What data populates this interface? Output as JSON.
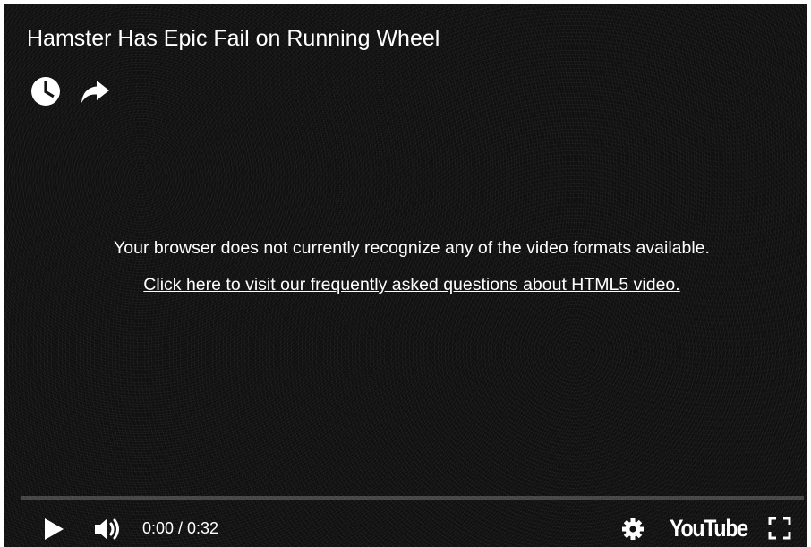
{
  "video": {
    "title": "Hamster Has Epic Fail on Running Wheel"
  },
  "top_actions": [
    {
      "icon": "clock-icon",
      "label": "Watch later"
    },
    {
      "icon": "share-icon",
      "label": "Share"
    }
  ],
  "error": {
    "message": "Your browser does not currently recognize any of the video formats available.",
    "link_text": "Click here to visit our frequently asked questions about HTML5 video."
  },
  "controls": {
    "current_time": "0:00",
    "separator": " / ",
    "duration": "0:32",
    "time_display": "0:00 / 0:32",
    "progress_fraction": 0,
    "brand": "YouTube",
    "icons": [
      "play-icon",
      "volume-icon",
      "gear-icon",
      "fullscreen-icon"
    ]
  },
  "colors": {
    "background": "#121212",
    "text": "#ffffff",
    "progress_track": "#3a3a3a"
  }
}
